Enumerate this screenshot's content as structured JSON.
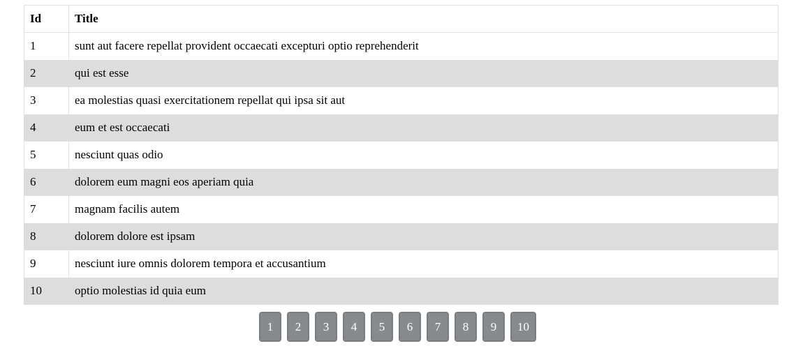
{
  "table": {
    "headers": {
      "id": "Id",
      "title": "Title"
    },
    "rows": [
      {
        "id": "1",
        "title": "sunt aut facere repellat provident occaecati excepturi optio reprehenderit"
      },
      {
        "id": "2",
        "title": "qui est esse"
      },
      {
        "id": "3",
        "title": "ea molestias quasi exercitationem repellat qui ipsa sit aut"
      },
      {
        "id": "4",
        "title": "eum et est occaecati"
      },
      {
        "id": "5",
        "title": "nesciunt quas odio"
      },
      {
        "id": "6",
        "title": "dolorem eum magni eos aperiam quia"
      },
      {
        "id": "7",
        "title": "magnam facilis autem"
      },
      {
        "id": "8",
        "title": "dolorem dolore est ipsam"
      },
      {
        "id": "9",
        "title": "nesciunt iure omnis dolorem tempora et accusantium"
      },
      {
        "id": "10",
        "title": "optio molestias id quia eum"
      }
    ],
    "row_alt_color": "#dddddd"
  },
  "pagination": {
    "pages": [
      "1",
      "2",
      "3",
      "4",
      "5",
      "6",
      "7",
      "8",
      "9",
      "10"
    ],
    "button_color": "#888b8d"
  }
}
